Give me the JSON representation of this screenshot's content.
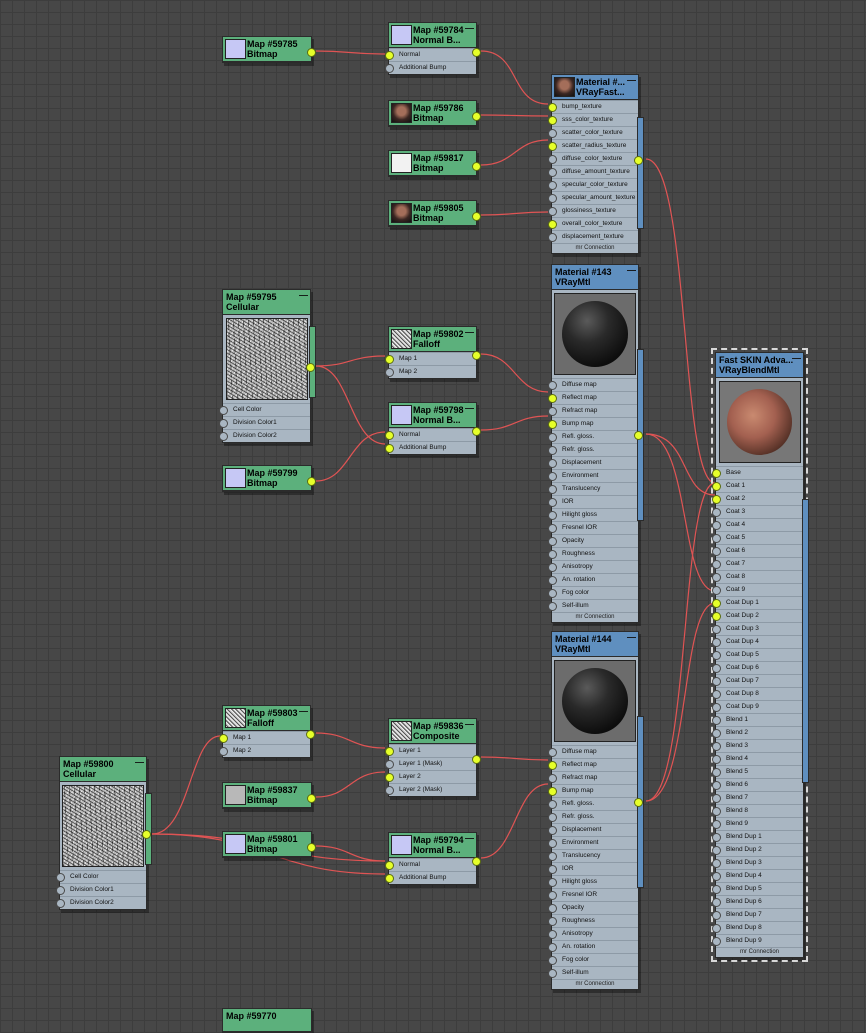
{
  "nodes": {
    "m59785": {
      "id": "Map #59785",
      "type": "Bitmap"
    },
    "m59784": {
      "id": "Map #59784",
      "type": "Normal B...",
      "slots": [
        "Normal",
        "Additional Bump"
      ]
    },
    "m59786": {
      "id": "Map #59786",
      "type": "Bitmap"
    },
    "m59817": {
      "id": "Map #59817",
      "type": "Bitmap"
    },
    "m59805": {
      "id": "Map #59805",
      "type": "Bitmap"
    },
    "matfast": {
      "id": "Material #...",
      "type": "VRayFast...",
      "slots": [
        "bump_texture",
        "sss_color_texture",
        "scatter_color_texture",
        "scatter_radius_texture",
        "diffuse_color_texture",
        "diffuse_amount_texture",
        "specular_color_texture",
        "specular_amount_texture",
        "glossiness_texture",
        "overall_color_texture",
        "displacement_texture"
      ],
      "footer": "mr Connection"
    },
    "m59795": {
      "id": "Map #59795",
      "type": "Cellular",
      "slots": [
        "Cell Color",
        "Division Color1",
        "Division Color2"
      ]
    },
    "m59802": {
      "id": "Map #59802",
      "type": "Falloff",
      "slots": [
        "Map 1",
        "Map 2"
      ]
    },
    "m59798": {
      "id": "Map #59798",
      "type": "Normal B...",
      "slots": [
        "Normal",
        "Additional Bump"
      ]
    },
    "m59799": {
      "id": "Map #59799",
      "type": "Bitmap"
    },
    "mat143": {
      "id": "Material #143",
      "type": "VRayMtl",
      "footer": "mr Connection"
    },
    "mat144": {
      "id": "Material #144",
      "type": "VRayMtl",
      "footer": "mr Connection"
    },
    "skin": {
      "id": "Fast SKIN Adva...",
      "type": "VRayBlendMtl",
      "footer": "mr Connection"
    },
    "m59803": {
      "id": "Map #59803",
      "type": "Falloff",
      "slots": [
        "Map 1",
        "Map 2"
      ]
    },
    "m59836": {
      "id": "Map #59836",
      "type": "Composite",
      "slots": [
        "Layer 1",
        "Layer 1 (Mask)",
        "Layer 2",
        "Layer 2 (Mask)"
      ]
    },
    "m59837": {
      "id": "Map #59837",
      "type": "Bitmap"
    },
    "m59800": {
      "id": "Map #59800",
      "type": "Cellular",
      "slots": [
        "Cell Color",
        "Division Color1",
        "Division Color2"
      ]
    },
    "m59801": {
      "id": "Map #59801",
      "type": "Bitmap"
    },
    "m59794": {
      "id": "Map #59794",
      "type": "Normal B...",
      "slots": [
        "Normal",
        "Additional Bump"
      ]
    },
    "m59770": {
      "id": "Map #59770",
      "type": ""
    }
  },
  "vraymtl_slots": [
    "Diffuse map",
    "Reflect map",
    "Refract map",
    "Bump map",
    "Refl. gloss.",
    "Refr. gloss.",
    "Displacement",
    "Environment",
    "Translucency",
    "IOR",
    "Hilight gloss",
    "Fresnel IOR",
    "Opacity",
    "Roughness",
    "Anisotropy",
    "An. rotation",
    "Fog color",
    "Self-illum"
  ],
  "blend_slots": [
    "Base",
    "Coat 1",
    "Coat 2",
    "Coat 3",
    "Coat 4",
    "Coat 5",
    "Coat 6",
    "Coat 7",
    "Coat 8",
    "Coat 9",
    "Coat Dup 1",
    "Coat Dup 2",
    "Coat Dup 3",
    "Coat Dup 4",
    "Coat Dup 5",
    "Coat Dup 6",
    "Coat Dup 7",
    "Coat Dup 8",
    "Coat Dup 9",
    "Blend 1",
    "Blend 2",
    "Blend 3",
    "Blend 4",
    "Blend 5",
    "Blend 6",
    "Blend 7",
    "Blend 8",
    "Blend 9",
    "Blend Dup 1",
    "Blend Dup 2",
    "Blend Dup 3",
    "Blend Dup 4",
    "Blend Dup 5",
    "Blend Dup 6",
    "Blend Dup 7",
    "Blend Dup 8",
    "Blend Dup 9"
  ],
  "colors": {
    "map_header": "#5cb07c",
    "material_header": "#5f8fbf",
    "node_body": "#a9b6c2",
    "wire": "#e05454",
    "socket_active": "#e6ff2a",
    "canvas": "#474747"
  },
  "icons": {
    "minimize": "minimize-icon",
    "socket": "socket-icon"
  }
}
